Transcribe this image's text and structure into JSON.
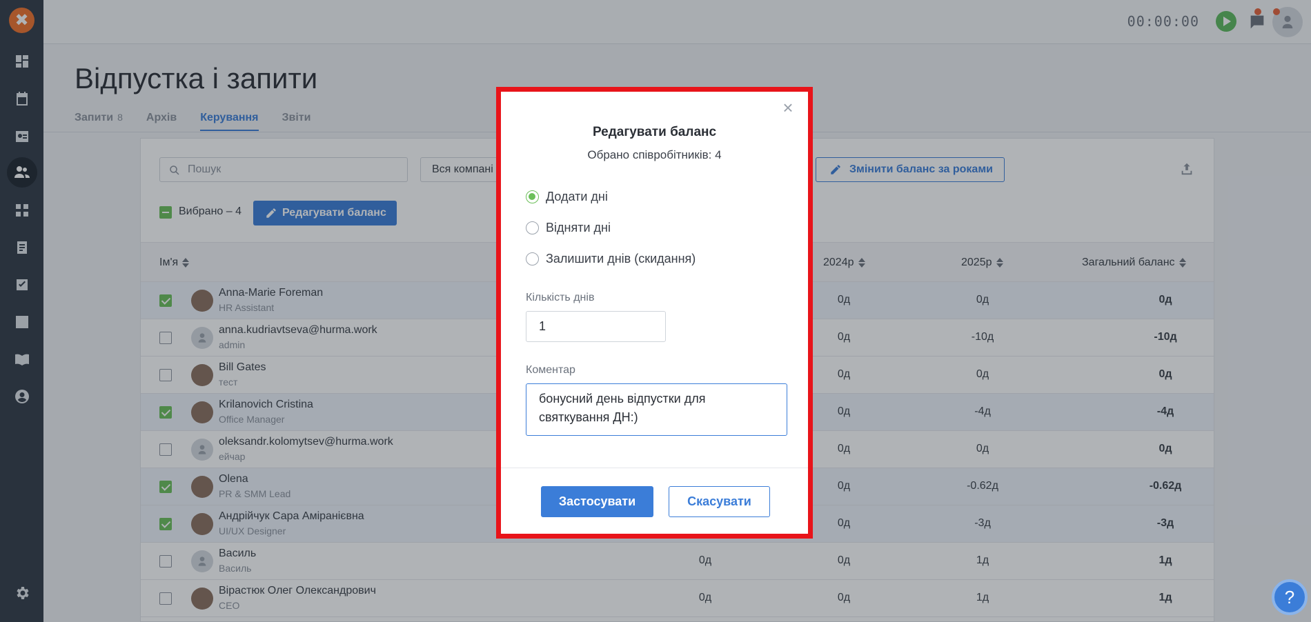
{
  "app": {
    "logo_glyph": "✖"
  },
  "sidebar": {
    "items": [
      {
        "icon": "dashboard-icon"
      },
      {
        "icon": "calendar-icon"
      },
      {
        "icon": "id-card-icon"
      },
      {
        "icon": "people-icon",
        "active": true
      },
      {
        "icon": "org-structure-icon"
      },
      {
        "icon": "documents-icon"
      },
      {
        "icon": "tasks-icon"
      },
      {
        "icon": "reports-icon"
      },
      {
        "icon": "knowledge-base-icon"
      },
      {
        "icon": "profile-icon"
      }
    ],
    "settings_icon": "gear-icon"
  },
  "topbar": {
    "timer": "00:00:00"
  },
  "page": {
    "title": "Відпустка і запити",
    "tabs": [
      {
        "label": "Запити",
        "count": "8"
      },
      {
        "label": "Архів",
        "count": ""
      },
      {
        "label": "Керування",
        "count": "",
        "active": true
      },
      {
        "label": "Звіти",
        "count": ""
      }
    ]
  },
  "toolbar": {
    "search_placeholder": "Пошук",
    "company_select": "Вся компані",
    "change_balance_label": "Змінити баланс за роками",
    "selected_label": "Вибрано – 4",
    "edit_balance_label": "Редагувати баланс"
  },
  "table": {
    "columns": [
      "Ім'я",
      "2024р",
      "2025р",
      "Загальний баланс"
    ],
    "rows": [
      {
        "name": "Anna-Marie Foreman",
        "role": "HR Assistant",
        "checked": true,
        "col_a": "",
        "y2024": "0д",
        "y2025": "0д",
        "total": "0д",
        "photo": true
      },
      {
        "name": "anna.kudriavtseva@hurma.work",
        "role": "admin",
        "checked": false,
        "col_a": "",
        "y2024": "0д",
        "y2025": "-10д",
        "total": "-10д",
        "photo": false
      },
      {
        "name": "Bill Gates",
        "role": "тест",
        "checked": false,
        "col_a": "",
        "y2024": "0д",
        "y2025": "0д",
        "total": "0д",
        "photo": true
      },
      {
        "name": "Krilanovich Cristina",
        "role": "Office Manager",
        "checked": true,
        "col_a": "",
        "y2024": "0д",
        "y2025": "-4д",
        "total": "-4д",
        "photo": true
      },
      {
        "name": "oleksandr.kolomytsev@hurma.work",
        "role": "ейчар",
        "checked": false,
        "col_a": "",
        "y2024": "0д",
        "y2025": "0д",
        "total": "0д",
        "photo": false
      },
      {
        "name": "Olena",
        "role": "PR & SMM Lead",
        "checked": true,
        "col_a": "",
        "y2024": "0д",
        "y2025": "-0.62д",
        "total": "-0.62д",
        "photo": true
      },
      {
        "name": "Андрійчук Сара Аміранієвна",
        "role": "UI/UX Designer",
        "checked": true,
        "col_a": "",
        "y2024": "0д",
        "y2025": "-3д",
        "total": "-3д",
        "photo": true
      },
      {
        "name": "Василь",
        "role": "Василь",
        "checked": false,
        "col_a": "0д",
        "y2024": "0д",
        "y2025": "1д",
        "total": "1д",
        "photo": false
      },
      {
        "name": "Вірастюк Олег Олександрович",
        "role": "CEO",
        "checked": false,
        "col_a": "0д",
        "y2024": "0д",
        "y2025": "1д",
        "total": "1д",
        "photo": true
      }
    ]
  },
  "modal": {
    "title": "Редагувати баланс",
    "subtitle": "Обрано співробітників: 4",
    "options": [
      {
        "label": "Додати дні",
        "selected": true
      },
      {
        "label": "Відняти дні",
        "selected": false
      },
      {
        "label": "Залишити днів (скидання)",
        "selected": false
      }
    ],
    "days_label": "Кількість днів",
    "days_value": "1",
    "comment_label": "Коментар",
    "comment_value": "бонусний день відпустки для святкування ДН:)",
    "apply_label": "Застосувати",
    "cancel_label": "Скасувати",
    "highlight_color": "#e8141a"
  },
  "help": {
    "label": "?"
  }
}
